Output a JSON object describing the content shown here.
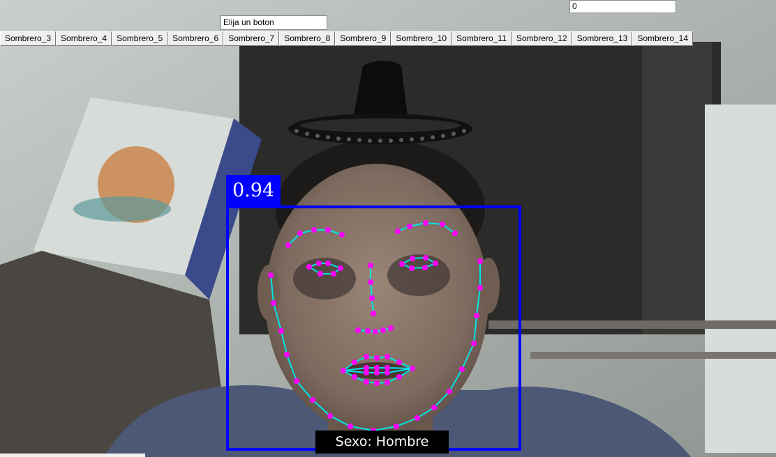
{
  "prompt_field": {
    "value": "Elija un boton"
  },
  "counter_field": {
    "value": "0"
  },
  "hat_buttons": [
    "Sombrero_3",
    "Sombrero_4",
    "Sombrero_5",
    "Sombrero_6",
    "Sombrero_7",
    "Sombrero_8",
    "Sombrero_9",
    "Sombrero_10",
    "Sombrero_11",
    "Sombrero_12",
    "Sombrero_13",
    "Sombrero_14"
  ],
  "detection": {
    "confidence": "0.94",
    "gender_caption": "Sexo: Hombre",
    "box_color": "#0000ff",
    "landmark_color": "#ff00ff",
    "mesh_color": "#00e5e5"
  }
}
